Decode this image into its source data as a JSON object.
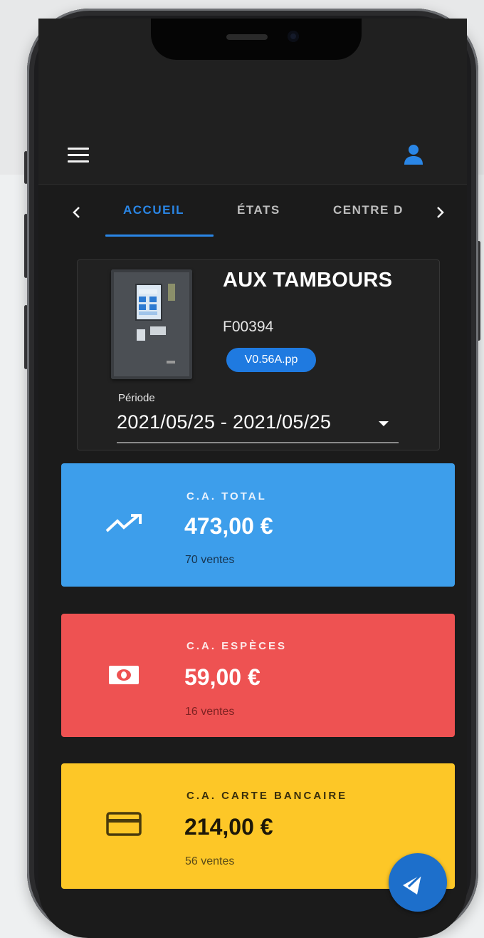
{
  "header": {
    "menu_icon": "hamburger-menu-icon",
    "account_icon": "user-icon"
  },
  "tabs": {
    "items": [
      {
        "label": "ACCUEIL",
        "active": true
      },
      {
        "label": "ÉTATS",
        "active": false
      },
      {
        "label": "CENTRE D",
        "active": false
      }
    ],
    "prev_icon": "chevron-left-icon",
    "next_icon": "chevron-right-icon"
  },
  "device": {
    "name": "AUX TAMBOURS",
    "id": "F00394",
    "version": "V0.56A.pp",
    "periode_label": "Période",
    "periode_value": "2021/05/25 - 2021/05/25"
  },
  "stats": [
    {
      "title": "C.A. TOTAL",
      "amount": "473,00 €",
      "count": "70 ventes",
      "icon": "trending-up-icon",
      "color": "#3d9eeb"
    },
    {
      "title": "C.A. ESPÈCES",
      "amount": "59,00 €",
      "count": "16 ventes",
      "icon": "banknote-icon",
      "color": "#ee5252"
    },
    {
      "title": "C.A. CARTE BANCAIRE",
      "amount": "214,00 €",
      "count": "56 ventes",
      "icon": "credit-card-icon",
      "color": "#fdc727"
    }
  ],
  "theme": {
    "accent": "#2a86e6",
    "background": "#1b1b1b"
  }
}
